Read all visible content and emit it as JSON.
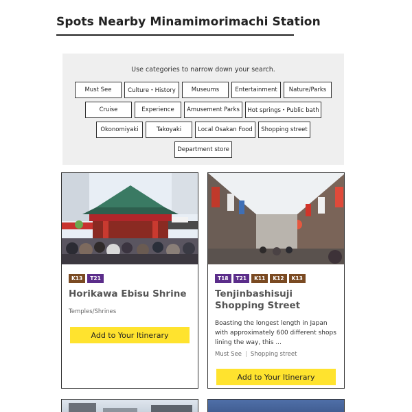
{
  "page": {
    "title": "Spots Nearby Minamimorimachi Station"
  },
  "filters": {
    "hint": "Use categories to narrow down your search.",
    "rows": [
      [
        "Must See",
        "Culture・History",
        "Museums",
        "Entertainment",
        "Nature/Parks"
      ],
      [
        "Cruise",
        "Experience",
        "Amusement Parks",
        "Hot springs・Public bath"
      ],
      [
        "Okonomiyaki",
        "Takoyaki",
        "Local Osakan Food",
        "Shopping street"
      ],
      [
        "Department store"
      ]
    ]
  },
  "cards": [
    {
      "image": "shrine-photo",
      "badges": [
        {
          "text": "K13",
          "color": "#7a4a22"
        },
        {
          "text": "T21",
          "color": "#5b2d8a"
        }
      ],
      "title": "Horikawa Ebisu Shrine",
      "category": "Temples/Shrines",
      "add_label": "Add to Your Itinerary"
    },
    {
      "image": "shopping-arcade-photo",
      "badges": [
        {
          "text": "T18",
          "color": "#5b2d8a"
        },
        {
          "text": "T21",
          "color": "#5b2d8a"
        },
        {
          "text": "K11",
          "color": "#7a4a22"
        },
        {
          "text": "K12",
          "color": "#7a4a22"
        },
        {
          "text": "K13",
          "color": "#7a4a22"
        }
      ],
      "title": "Tenjinbashisuji Shopping Street",
      "description": "Boasting the longest length in Japan with approximately 600 different shops lining the way, this ...",
      "tags": [
        "Must See",
        "Shopping street"
      ],
      "add_label": "Add to Your Itinerary"
    }
  ],
  "colors": {
    "accent_yellow": "#ffe32e",
    "panel_gray": "#efefef"
  }
}
